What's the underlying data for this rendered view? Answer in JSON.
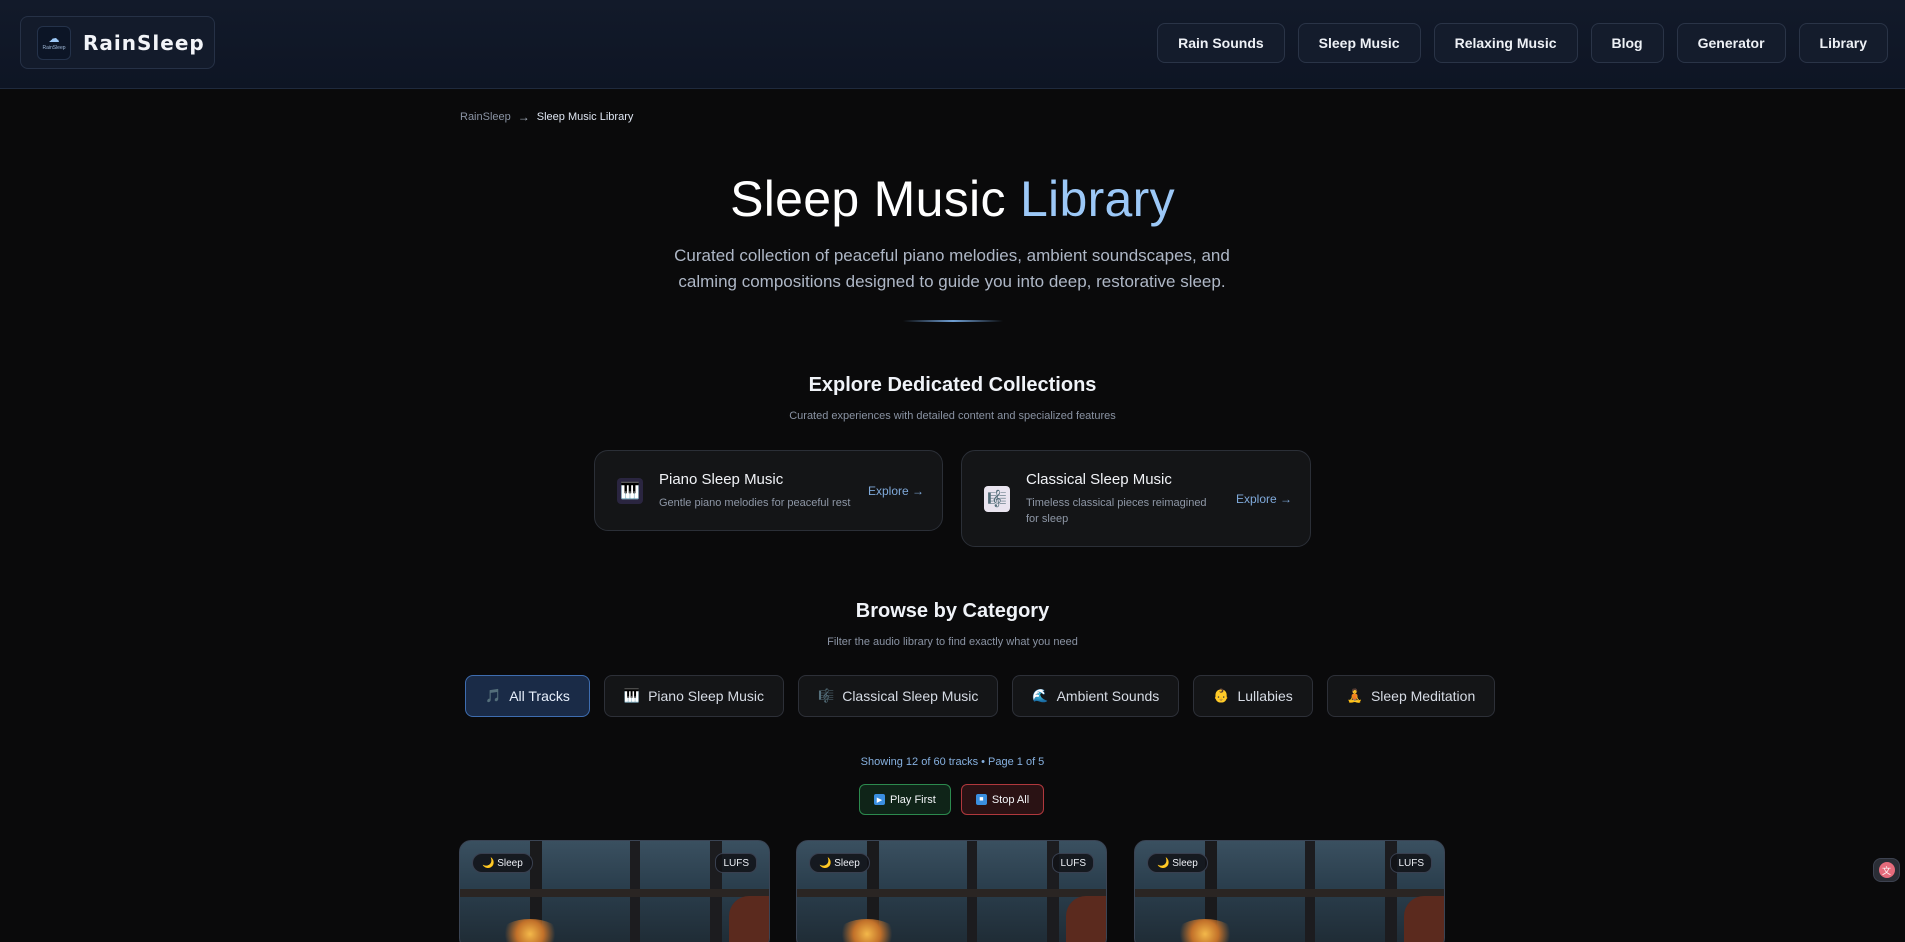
{
  "brand": {
    "name": "RainSleep",
    "logo_text": "RainSleep"
  },
  "nav": {
    "items": [
      "Rain Sounds",
      "Sleep Music",
      "Relaxing Music",
      "Blog",
      "Generator",
      "Library"
    ]
  },
  "breadcrumb": {
    "home": "RainSleep",
    "separator": "→",
    "current": "Sleep Music Library"
  },
  "hero": {
    "title_main": "Sleep Music ",
    "title_accent": "Library",
    "subtitle": "Curated collection of peaceful piano melodies, ambient soundscapes, and calming compositions designed to guide you into deep, restorative sleep."
  },
  "collections": {
    "heading": "Explore Dedicated Collections",
    "subheading": "Curated experiences with detailed content and specialized features",
    "cards": [
      {
        "icon": "🎹",
        "title": "Piano Sleep Music",
        "desc": "Gentle piano melodies for peaceful rest",
        "cta": "Explore →"
      },
      {
        "icon": "🎼",
        "title": "Classical Sleep Music",
        "desc": "Timeless classical pieces reimagined for sleep",
        "cta": "Explore →"
      }
    ]
  },
  "categories": {
    "heading": "Browse by Category",
    "subheading": "Filter the audio library to find exactly what you need",
    "filters": [
      {
        "icon": "🎵",
        "label": "All Tracks"
      },
      {
        "icon": "🎹",
        "label": "Piano Sleep Music"
      },
      {
        "icon": "🎼",
        "label": "Classical Sleep Music"
      },
      {
        "icon": "🌊",
        "label": "Ambient Sounds"
      },
      {
        "icon": "👶",
        "label": "Lullabies"
      },
      {
        "icon": "🧘",
        "label": "Sleep Meditation"
      }
    ],
    "active": "All Tracks"
  },
  "status": {
    "showing": "Showing 12 of 60 tracks • Page 1 of 5"
  },
  "actions": {
    "play_first": "Play First",
    "stop_all": "Stop All"
  },
  "tracks": [
    {
      "tag": "🌙 Sleep",
      "badge": "LUFS"
    },
    {
      "tag": "🌙 Sleep",
      "badge": "LUFS"
    },
    {
      "tag": "🌙 Sleep",
      "badge": "LUFS"
    }
  ],
  "fab": {
    "icon": "translate-icon",
    "glyph": "文"
  },
  "colors": {
    "accent": "#9cc8f7",
    "active_filter": "#1a2b47",
    "play": "#2c8a4e",
    "stop": "#b0383d"
  }
}
